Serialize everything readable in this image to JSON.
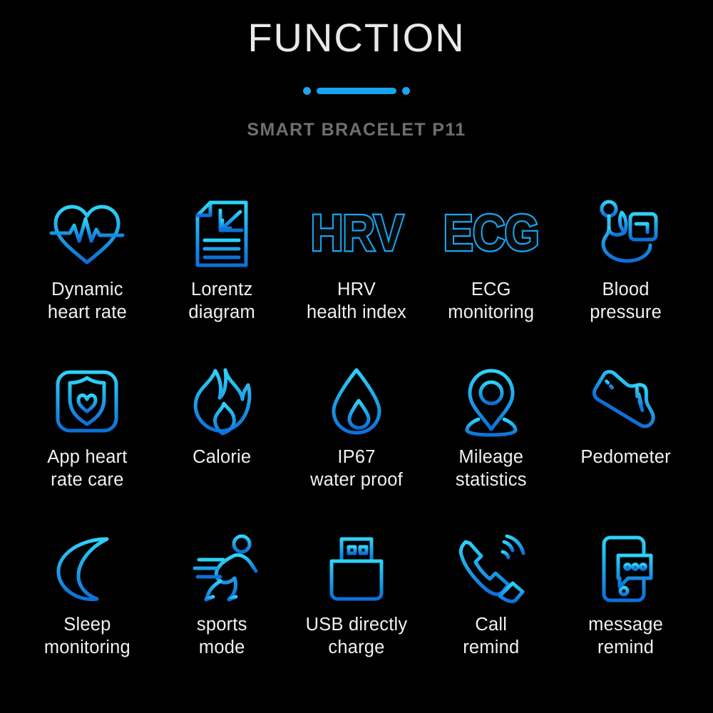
{
  "header": {
    "title": "FUNCTION",
    "subtitle": "SMART BRACELET P11",
    "divider": {
      "left_dot": "dot",
      "bar": "bar",
      "right_dot": "dot"
    }
  },
  "colors": {
    "background": "#000000",
    "title_text": "#e8e9ea",
    "subtitle_text": "#6d6f72",
    "label_text": "#f0f1f2",
    "accent_cyan": "#25c8f5",
    "accent_blue": "#127fe0",
    "divider_blue": "#19a3ef"
  },
  "features": [
    {
      "icon": "heart-rate-pulse-icon",
      "label": "Dynamic\nheart rate"
    },
    {
      "icon": "document-chart-icon",
      "label": "Lorentz\ndiagram"
    },
    {
      "icon": "hrv-text-icon",
      "label": "HRV\nhealth index",
      "glyph_text": "HRV"
    },
    {
      "icon": "ecg-text-icon",
      "label": "ECG\nmonitoring",
      "glyph_text": "ECG"
    },
    {
      "icon": "blood-pressure-monitor-icon",
      "label": "Blood\npressure"
    },
    {
      "icon": "shield-heart-app-icon",
      "label": "App heart\nrate care"
    },
    {
      "icon": "flame-icon",
      "label": "Calorie"
    },
    {
      "icon": "water-drop-icon",
      "label": "IP67\nwater proof"
    },
    {
      "icon": "location-pin-icon",
      "label": "Mileage\nstatistics"
    },
    {
      "icon": "sneaker-icon",
      "label": "Pedometer"
    },
    {
      "icon": "crescent-moon-icon",
      "label": "Sleep\nmonitoring"
    },
    {
      "icon": "running-person-icon",
      "label": "sports\nmode"
    },
    {
      "icon": "usb-plug-icon",
      "label": "USB directly\ncharge"
    },
    {
      "icon": "phone-handset-icon",
      "label": "Call\nremind"
    },
    {
      "icon": "phone-message-icon",
      "label": "message\nremind"
    }
  ]
}
